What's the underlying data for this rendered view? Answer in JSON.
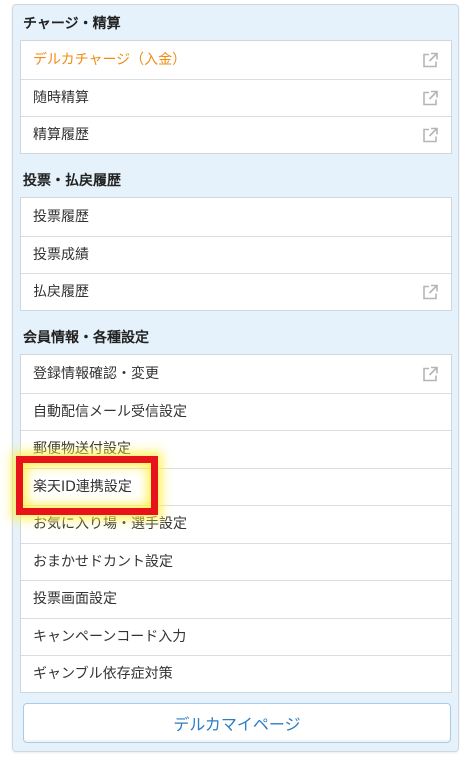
{
  "sections": [
    {
      "title": "チャージ・精算",
      "items": [
        {
          "label": "デルカチャージ（入金）",
          "external": true,
          "highlight": true
        },
        {
          "label": "随時精算",
          "external": true
        },
        {
          "label": "精算履歴",
          "external": true
        }
      ]
    },
    {
      "title": "投票・払戻履歴",
      "items": [
        {
          "label": "投票履歴",
          "external": false
        },
        {
          "label": "投票成績",
          "external": false
        },
        {
          "label": "払戻履歴",
          "external": true
        }
      ]
    },
    {
      "title": "会員情報・各種設定",
      "items": [
        {
          "label": "登録情報確認・変更",
          "external": true
        },
        {
          "label": "自動配信メール受信設定",
          "external": false
        },
        {
          "label": "郵便物送付設定",
          "external": false
        },
        {
          "label": "楽天ID連携設定",
          "external": false,
          "annotated": true
        },
        {
          "label": "お気に入り場・選手設定",
          "external": false
        },
        {
          "label": "おまかせドカント設定",
          "external": false
        },
        {
          "label": "投票画面設定",
          "external": false
        },
        {
          "label": "キャンペーンコード入力",
          "external": false
        },
        {
          "label": "ギャンブル依存症対策",
          "external": false
        }
      ]
    }
  ],
  "mypage_button": {
    "label": "デルカマイページ"
  },
  "colors": {
    "panel_bg": "#e6f2fb",
    "highlight_text": "#f08c14",
    "button_text": "#2c7dc4",
    "annotation_box": "#e8121b",
    "annotation_glow": "#fff03c"
  },
  "icons": {
    "external_link": "external-link-icon"
  }
}
